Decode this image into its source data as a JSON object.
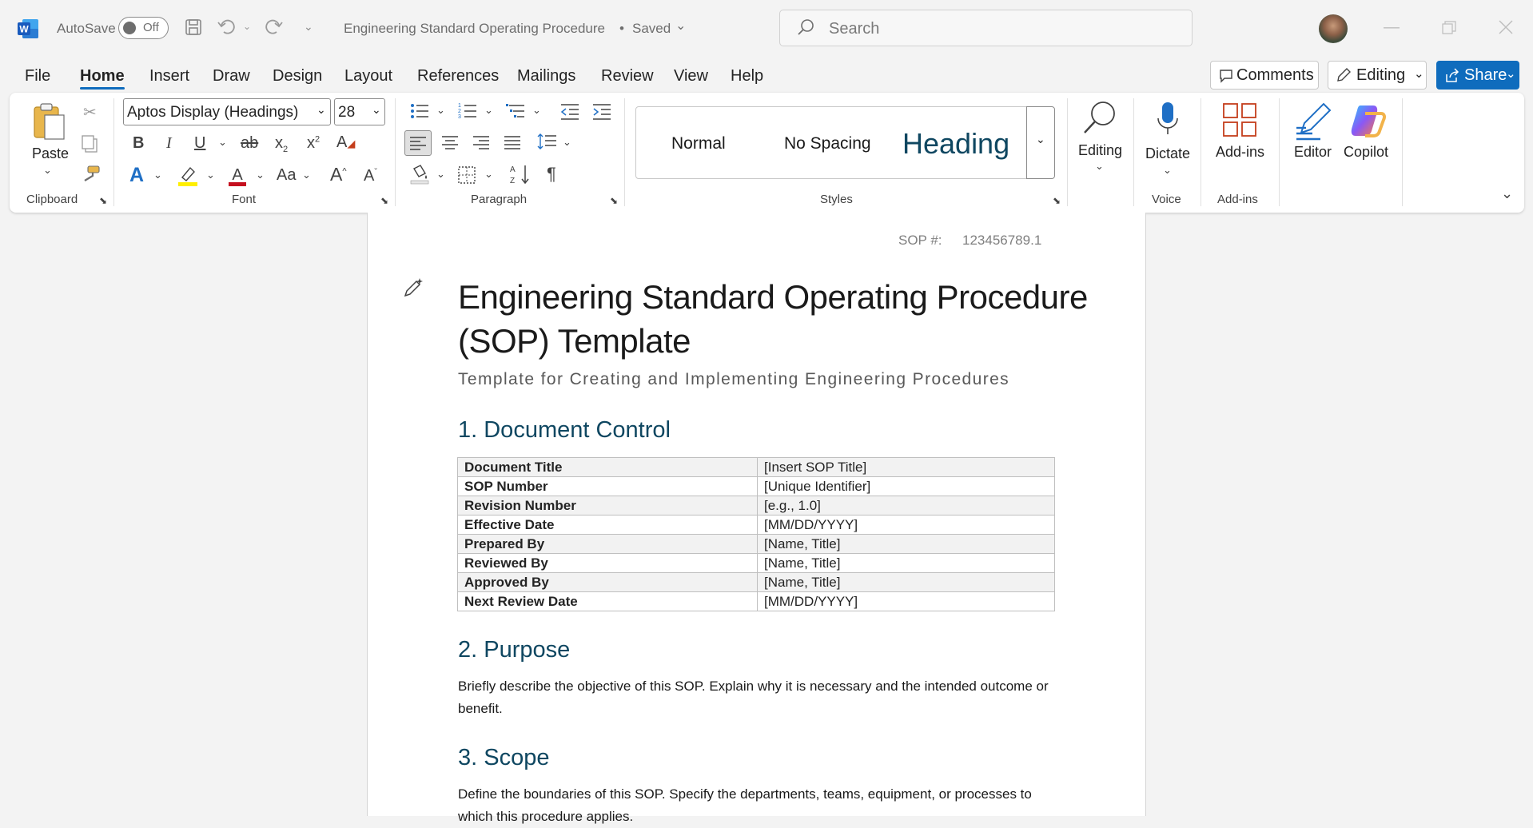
{
  "titlebar": {
    "autosave_label": "AutoSave",
    "autosave_state": "Off",
    "doc_title": "Engineering Standard Operating Procedure",
    "save_status": "Saved",
    "search_placeholder": "Search"
  },
  "menu": {
    "tabs": [
      "File",
      "Home",
      "Insert",
      "Draw",
      "Design",
      "Layout",
      "References",
      "Mailings",
      "Review",
      "View",
      "Help"
    ],
    "active": "Home",
    "comments_label": "Comments",
    "editing_label": "Editing",
    "share_label": "Share"
  },
  "ribbon": {
    "clipboard": {
      "paste_label": "Paste",
      "group": "Clipboard"
    },
    "font": {
      "family": "Aptos Display (Headings)",
      "size": "28",
      "group": "Font"
    },
    "paragraph": {
      "group": "Paragraph"
    },
    "styles": {
      "normal": "Normal",
      "no_spacing": "No Spacing",
      "heading": "Heading",
      "group": "Styles"
    },
    "editing": {
      "label": "Editing"
    },
    "voice": {
      "label": "Dictate",
      "group": "Voice"
    },
    "addins": {
      "label": "Add-ins",
      "group": "Add-ins"
    },
    "editor": {
      "label": "Editor"
    },
    "copilot": {
      "label": "Copilot"
    }
  },
  "document": {
    "sop_label": "SOP #:",
    "sop_number": "123456789.1",
    "title_line1": "Engineering Standard Operating Procedure",
    "title_line2": "(SOP) Template",
    "subtitle": "Template for Creating and Implementing Engineering Procedures",
    "section1": "1. Document Control",
    "control_table": [
      {
        "key": "Document Title",
        "value": "[Insert SOP Title]"
      },
      {
        "key": "SOP Number",
        "value": "[Unique Identifier]"
      },
      {
        "key": "Revision Number",
        "value": "[e.g., 1.0]"
      },
      {
        "key": "Effective Date",
        "value": "[MM/DD/YYYY]"
      },
      {
        "key": "Prepared By",
        "value": "[Name, Title]"
      },
      {
        "key": "Reviewed By",
        "value": "[Name, Title]"
      },
      {
        "key": "Approved By",
        "value": "[Name, Title]"
      },
      {
        "key": "Next Review Date",
        "value": "[MM/DD/YYYY]"
      }
    ],
    "section2": "2. Purpose",
    "purpose_text": "Briefly describe the objective of this SOP. Explain why it is necessary and the intended outcome or benefit.",
    "section3": "3. Scope",
    "scope_text": "Define the boundaries of this SOP. Specify the departments, teams, equipment, or processes to which this procedure applies."
  },
  "colors": {
    "accent": "#0f6cbd",
    "heading": "#0f4761",
    "word_blue": "#185abd"
  }
}
